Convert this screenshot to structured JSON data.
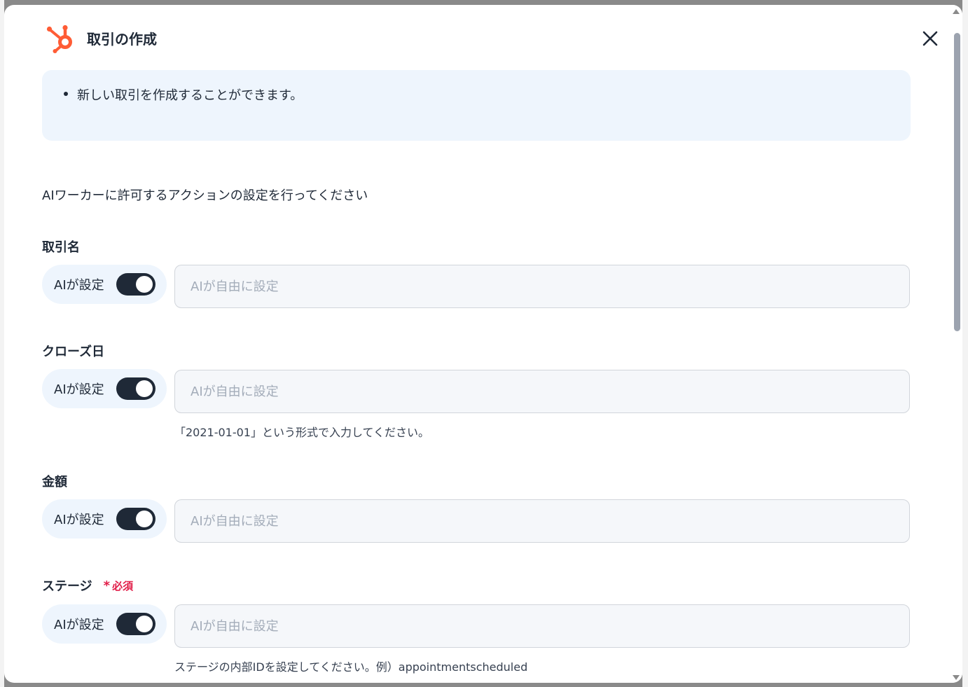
{
  "dialog": {
    "title": "取引の作成",
    "info_items": [
      "新しい取引を作成することができます。"
    ],
    "instruction": "AIワーカーに許可するアクションの設定を行ってください",
    "fields": [
      {
        "label": "取引名",
        "required": false,
        "ai_label": "AIが設定",
        "ai_enabled": true,
        "placeholder": "AIが自由に設定",
        "value": "",
        "hint": ""
      },
      {
        "label": "クローズ日",
        "required": false,
        "ai_label": "AIが設定",
        "ai_enabled": true,
        "placeholder": "AIが自由に設定",
        "value": "",
        "hint": "「2021-01-01」という形式で入力してください。"
      },
      {
        "label": "金額",
        "required": false,
        "ai_label": "AIが設定",
        "ai_enabled": true,
        "placeholder": "AIが自由に設定",
        "value": "",
        "hint": ""
      },
      {
        "label": "ステージ",
        "required": true,
        "required_label": "必須",
        "ai_label": "AIが設定",
        "ai_enabled": true,
        "placeholder": "AIが自由に設定",
        "value": "",
        "hint": "ステージの内部IDを設定してください。例）appointmentscheduled"
      }
    ]
  },
  "icons": {
    "logo": "hubspot-logo-icon",
    "close": "close-icon"
  },
  "colors": {
    "accent_orange": "#ff5c35",
    "required_red": "#e11d48",
    "info_bg": "#eef5fd",
    "toggle_on": "#1f2937"
  }
}
